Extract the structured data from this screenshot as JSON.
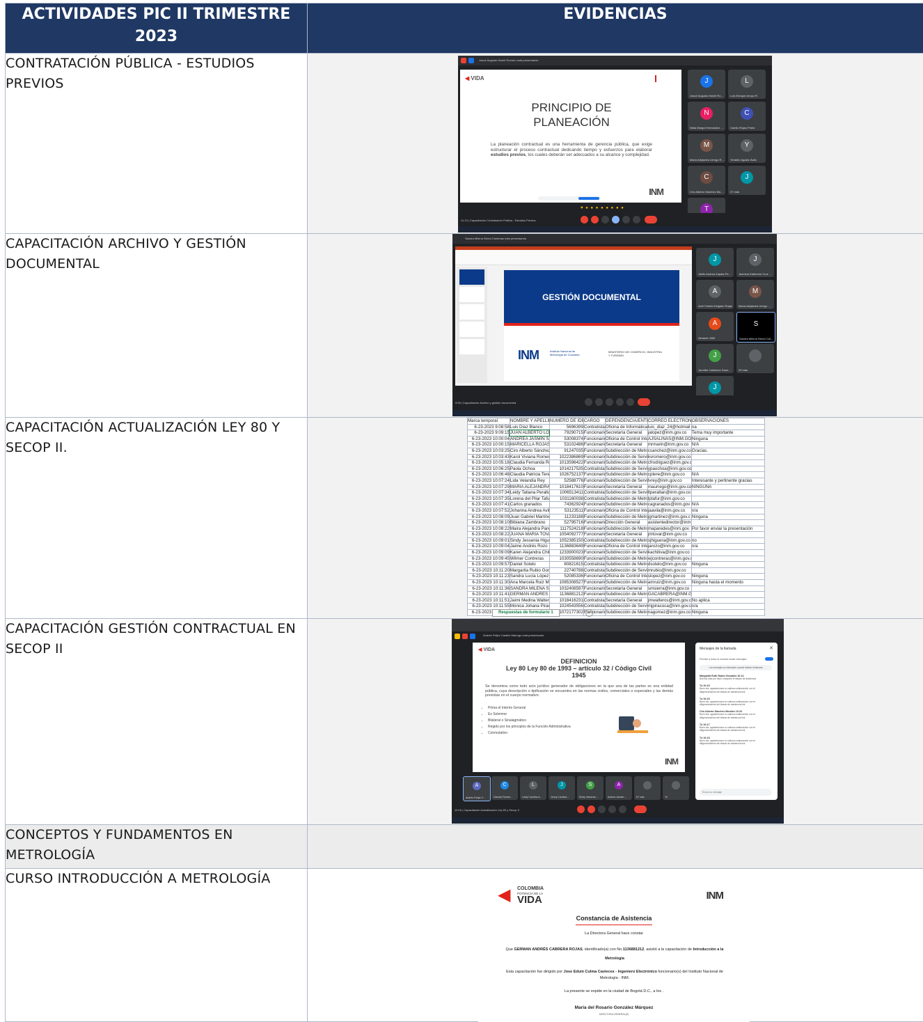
{
  "header": {
    "col1": "ACTIVIDADES PIC II TRIMESTRE 2023",
    "col2": "EVIDENCIAS"
  },
  "rows": [
    {
      "activity": "CONTRATACIÓN PÚBLICA - ESTUDIOS PREVIOS"
    },
    {
      "activity": "CAPACITACIÓN ARCHIVO Y GESTIÓN DOCUMENTAL"
    },
    {
      "activity": "CAPACITACIÓN ACTUALIZACIÓN LEY 80 Y SECOP II."
    },
    {
      "activity": "CAPACITACIÓN GESTIÓN CONTRACTUAL EN SECOP II"
    },
    {
      "activity": "CONCEPTOS Y FUNDAMENTOS EN METROLOGÍA"
    },
    {
      "activity": "CURSO INTRODUCCIÓN A METROLOGÍA"
    }
  ],
  "shot1": {
    "presenting": "Josué Augusto Muriel Romero está presentando",
    "slide_title": "PRINCIPIO DE PLANEACIÓN",
    "slide_body_pre": "La planeación contractual es una herramienta de gerencia pública, que exige estructurar el proceso contractual dedicando tiempo y esfuerzos para elaborar ",
    "slide_body_bold": "estudios previos",
    "slide_body_post": ", los cuales deberán ser adecuados a su alcance y complejidad.",
    "logo_left": "VIDA",
    "logo_right": "INM",
    "meeting": "11:13 | Capacitación Contratación Pública - Estudios Previos",
    "tiles": [
      {
        "name": "Josué Augusto Muriel Ro...",
        "initial": "J",
        "color": "#1a73e8"
      },
      {
        "name": "Luis Enrique Arroyo R.",
        "initial": "L",
        "color": "#5f6368"
      },
      {
        "name": "Nidia Margot Hernández ...",
        "initial": "N",
        "color": "#e91e63"
      },
      {
        "name": "Camilo Rojas Prieto",
        "initial": "C",
        "color": "#3f51b5"
      },
      {
        "name": "María Alejandra Urrego R...",
        "initial": "M",
        "color": "#795548"
      },
      {
        "name": "Yeraldín Aguilar Ávila",
        "initial": "Y",
        "color": "#5f6368"
      },
      {
        "name": "Ciro Alberto Sánchez Mo...",
        "initial": "C",
        "color": "#6d4c41"
      },
      {
        "name": "37 más",
        "initial": "J",
        "color": "#0097a7"
      },
      {
        "name": "Tú",
        "initial": "T",
        "color": "#8e24aa"
      }
    ]
  },
  "shot2": {
    "presenting": "Sandra Milena Sierra Cárdenas está presentando",
    "slide_title": "GESTIÓN DOCUMENTAL",
    "inm": "INM",
    "inm_sub": "Instituto Nacional de Metrología de Colombia",
    "ministry": "MINISTERIO DE COMERCIO, INDUSTRIA Y TURISMO",
    "meeting": "9:06 | Capacitación Archivo y gestión documental",
    "tiles": [
      {
        "name": "Jeidis Andrea Zapata Pe...",
        "initial": "J",
        "color": "#0097a7"
      },
      {
        "name": "Jazmina Katherine Cruz ...",
        "initial": "J",
        "color": "#5f6368"
      },
      {
        "name": "Ariel Farieta Delgado Rojas",
        "initial": "A",
        "color": "#5f6368"
      },
      {
        "name": "María Alejandra Urrego ...",
        "initial": "M",
        "color": "#795548"
      },
      {
        "name": "Almacén INM",
        "initial": "A",
        "color": "#e64a19"
      },
      {
        "name": "Sandra Milena Sierra Cár...",
        "initial": "S",
        "color": "#000000"
      },
      {
        "name": "Jennifer Catherine Sarm...",
        "initial": "J",
        "color": "#43a047"
      },
      {
        "name": "29 más",
        "initial": "",
        "color": "#5f6368"
      },
      {
        "name": "Tú",
        "initial": "J",
        "color": "#0097a7"
      }
    ]
  },
  "sheet": {
    "headers": [
      "Marca temporal",
      "NOMBRE Y APELLIDO",
      "NUMERO DE IDENTIFICA",
      "CARGO",
      "DEPENDENCIA/ENTE",
      "CORREO ELECTRÓN",
      "OBSERVACIONES"
    ],
    "rows": [
      [
        "6-23-2023 9:08:58",
        "Luis Díaz Blanco",
        "5696399",
        "Contratista",
        "Oficina de Informática",
        "luis_diaz_24@hotmail",
        "na"
      ],
      [
        "6-23-2023 9:09:15",
        "JUAN ALBERTO LOPE",
        "79290715",
        "Funcionario",
        "Secretaría General",
        "jalopez@inm.gov.co",
        "Tema muy importante"
      ],
      [
        "6-23-2023 10:00:04",
        "ANDREA JASMIN SAL",
        "53008374",
        "Funcionario",
        "Oficina de Control Inte",
        "AJSALINAS@INM.GO",
        "Ninguna"
      ],
      [
        "6-23-2023 10:00:15",
        "MARICELLA ROJAS M",
        "53102486",
        "Funcionario",
        "Secretaría General",
        "mrmarin@inm.gov.co",
        "N/A"
      ],
      [
        "6-23-2023 10:03:25",
        "Ciro Alberto Sánchez",
        "91247035",
        "Funcionario",
        "Subdirección de Metro",
        "csanchez@inm.gov.co",
        "Gracias."
      ],
      [
        "6-23-2023 10:03:43",
        "Karol Viviana Romero",
        "1022386869",
        "Funcionario",
        "Subdirección de Servic",
        "kvromero@inm.gov.co",
        ""
      ],
      [
        "6-23-2023 10:05:18",
        "Claudia Fernanda Rod",
        "1013596422",
        "Funcionario",
        "Subdirección de Metro",
        "cfrodriguez@inm.gov.co",
        ""
      ],
      [
        "6-23-2023 10:06:25",
        "Paola Ochoa",
        "1014217535",
        "Contratista",
        "Subdirección de Servic",
        "ypaochoa@inm.gov.co",
        ""
      ],
      [
        "6-23-2023 10:06:48",
        "Claudia Patricia Tere F",
        "1026752137",
        "Funcionario",
        "Subdirección de Metro",
        "cptere@inm.gov.co",
        "N/A"
      ],
      [
        "6-23-2023 10:07:24",
        "Lida Velandia Rey",
        "52588776",
        "Funcionario",
        "Subdirección de Servic",
        "lvrey@inm.gov.co",
        "Interesante y pertinente gracias"
      ],
      [
        "6-23-2023 10:07:29",
        "MARIA ALEJANDRA U",
        "1018417610",
        "Funcionario",
        "Secretaría General",
        "maurrego@inm.gov.co",
        "NINGUNA"
      ],
      [
        "6-23-2023 10:07:34",
        "Leidy Tatiana Peraltan",
        "1006513411",
        "Contratista",
        "Subdirección de Servic",
        "ltperaltan@inm.gov.co",
        ""
      ],
      [
        "6-23-2023 10:07:35",
        "Lorena del Pilar Tafur I",
        "1031160038",
        "Contratista",
        "Subdirección de Metro",
        "lptafur@inm.gov.co",
        ""
      ],
      [
        "6-23-2023 10:07:41",
        "Carlos granados",
        "74362924",
        "Funcionario",
        "Subdirección de Metro",
        "cagranados@inm.gov",
        "N/A"
      ],
      [
        "6-23-2023 10:07:52",
        "Johanna Andrea Avila",
        "53123511",
        "Funcionario",
        "Oficina de Control Inte",
        "jaavila@inm.gov.co",
        "n/a"
      ],
      [
        "6-23-2023 10:08:09",
        "Juan Gabriel Martínez",
        "11233188",
        "Funcionario",
        "Subdirección de Metro",
        "jgmartinez@inm.gov.c",
        "Ninguna"
      ],
      [
        "6-23-2023 10:08:10",
        "Bibiana Zambrano",
        "52795716",
        "Funcionario",
        "Dirección General",
        "asistentedirector@inm.gov.co",
        ""
      ],
      [
        "6-23-2023 10:08:22",
        "Maira Alejandra Pared",
        "1117524218",
        "Funcionario",
        "Subdirección de Metro",
        "maparedes@inm.gov.",
        "Por favor enviar la presentación"
      ],
      [
        "6-23-2023 10:08:22",
        "JUANA MARIA TOVAR",
        "1054092777",
        "Funcionario",
        "Secretaría General",
        "jmtovar@inm.gov.co",
        ""
      ],
      [
        "6-23-2023 10:09:01",
        "Sindy Jessenia Higuer",
        "1052385150",
        "Contratista",
        "Subdirección de Metro",
        "sjhiguera@inm.gov.co",
        "no"
      ],
      [
        "6-23-2023 10:09:04",
        "Jaime Andrés Rozo",
        "1136883649",
        "Funcionario",
        "Oficina de Control Inte",
        "jarozo@inm.gov.co",
        "n/a"
      ],
      [
        "6-23-2023 10:09:09",
        "Karen Alejandra Chitiv",
        "1233900023",
        "Funcionario",
        "Subdirección de Servic",
        "kachitiva@inm.gov.co",
        ""
      ],
      [
        "6-23-2023 10:09:45",
        "Wilmer Contreras",
        "1030558690",
        "Funcionario",
        "Subdirección de Metro",
        "wjcontreras@inm.gov.co",
        ""
      ],
      [
        "6-23-2023 10:09:57",
        "Daniel Sotelo",
        "80821615",
        "Contratista",
        "Subdirección de Metro",
        "dsotelo@inm.gov.co",
        "Ninguna"
      ],
      [
        "6-23-2023 10:11:20",
        "Margarita Rubio Gonzá",
        "22740788",
        "Contratista",
        "Subdirección de Servic",
        "mrubio@inm.gov.co",
        ""
      ],
      [
        "6-23-2023 10:11:23",
        "Sandra Lucía López P",
        "52085336",
        "Funcionario",
        "Oficina de Control Inte",
        "slopez@inm.gov.co",
        "Ninguna"
      ],
      [
        "6-23-2023 10:11:30",
        "Ana Marcela Ruiz Mor",
        "1085308527",
        "Funcionario",
        "Subdirección de Metro",
        "amruiz@inm.gov.co",
        "Ninguna hasta el momento"
      ],
      [
        "6-23-2023 10:11:36",
        "SANDRA MILENA SIE",
        "1032408597",
        "Funcionario",
        "Secretaría General",
        "smsierra@inm.gov.co",
        ""
      ],
      [
        "6-23-2023 10:11:41",
        "GERMÁN ANDRÉS C",
        "1136881212",
        "Funcionario",
        "Subdirección de Metro",
        "GACABRERA@INM.GOV.CO",
        ""
      ],
      [
        "6-23-2023 10:11:51",
        "Jaimi Medina Walteros",
        "1018416231",
        "Contratista",
        "Secretaría General",
        "jmwalteros@inm.gov.c",
        "No aplica"
      ],
      [
        "6-23-2023 10:11:55",
        "Mónica Johana Piraco",
        "1024543556",
        "Contratista",
        "Subdirección de Servic",
        "mjpiracoca@inm.gov.c",
        "n/a"
      ],
      [
        "6-23-2023 10:13:08",
        "Nathalia Andrea Góme",
        "1072177302",
        "Funcionario",
        "Subdirección de Metro",
        "nagomez@inm.gov.co",
        "Ninguna"
      ]
    ],
    "tab": "Respuestas de formulario 1"
  },
  "shot4": {
    "presenting": "Andrés Felipe Castelo Marrugo está presentando",
    "slide_head1": "DEFINICION",
    "slide_head2": "Ley 80 Ley 80 de 1993 – artículo 32 / Código Civil",
    "slide_head3": "1945",
    "slide_body": "Se denomina como todo acto jurídico generador de obligaciones en la que una de las partes es una entidad pública, cuya descripción o tipificación se encuentra en las normas civiles, comerciales o especiales y las demás previstas en el cuerpo normativo.",
    "bullets": [
      "Prima el Interés General",
      "Es Solemne",
      "Bilateral o Sinalagmático",
      "Regido por los principios de la Función Administrativa",
      "Conmutativo"
    ],
    "chat_title": "Mensajes de la llamada",
    "chat_toggle": "Permitir a todos el mostrar enviar mensajes",
    "chat_notice": "Los mensajes se eliminarán cuando finalice la llamada",
    "chat_msgs": [
      {
        "who": "Margarita Ruth Rubio González 10:14",
        "text": "Buenos días por favor compartir el listado de asistencia"
      },
      {
        "who": "Tú 10:15",
        "text": "Buen día, agradecemos su valiosa colaboración con el diligenciamiento del listado de asistencia link"
      },
      {
        "who": "Tú 10:15",
        "text": "Buen día, agradecemos su valiosa colaboración con el diligenciamiento del listado de asistencia link"
      },
      {
        "who": "Ciro Alberto Sánchez Morales 10:16",
        "text": "Buen día, agradecemos su valiosa colaboración con el diligenciamiento del listado de asistencia link"
      },
      {
        "who": "Tú 10:17",
        "text": "Buen día, agradecemos su valiosa colaboración con el diligenciamiento del listado de asistencia link"
      },
      {
        "who": "Tú 10:18",
        "text": "Buen día, agradecemos su valiosa colaboración con el diligenciamiento del listado de asistencia link"
      }
    ],
    "chat_input": "Envía un mensaje",
    "meeting": "10:16 | Capacitación Actualización Ley 80 y Secop II",
    "tiles": [
      {
        "name": "Andrés Felipe C...",
        "initial": "A",
        "color": "#5c6bc0"
      },
      {
        "name": "Claudia Fernan...",
        "initial": "C",
        "color": "#1e88e5"
      },
      {
        "name": "Leidy Carolina A...",
        "initial": "L",
        "color": "#5f6368"
      },
      {
        "name": "Jenny Carolina ...",
        "initial": "J",
        "color": "#0097a7"
      },
      {
        "name": "Sindy Jessenia ...",
        "initial": "S",
        "color": "#43a047"
      },
      {
        "name": "Andrea Jasmin ...",
        "initial": "A",
        "color": "#8e24aa"
      },
      {
        "name": "67 más",
        "initial": "",
        "color": "#5f6368"
      },
      {
        "name": "Tú",
        "initial": "",
        "color": "#5f6368"
      }
    ]
  },
  "cert": {
    "logo_colombia": "COLOMBIA",
    "logo_potencia": "POTENCIA DE LA",
    "logo_vida": "VIDA",
    "logo_inm": "INM",
    "title": "Constancia de Asistencia",
    "subtitle": "La Directora General hace constar",
    "line1_a": "Que ",
    "line1_name": "GERMAN ANDRÉS CABRERA ROJAS",
    "line1_b": ", identificado(a) con No.",
    "line1_id": "1136881212",
    "line1_c": ", asistió a la capacitación de ",
    "line1_course": "Introducción a la Metrología",
    "line2_a": "Esta capacitación fue dirigido por ",
    "line2_name": "Jose Eduin Culma Cavieces - Ingeniero Electrónico",
    "line2_b": " funcionario(s) del Instituto Nacional de Metrología - INM.",
    "line3": "La presente se expide en la ciudad de Bogotá D.C., a los .",
    "signer": "María del Rosario González Márquez",
    "signer_role": "DIRECTORA GENERAL(E)"
  }
}
